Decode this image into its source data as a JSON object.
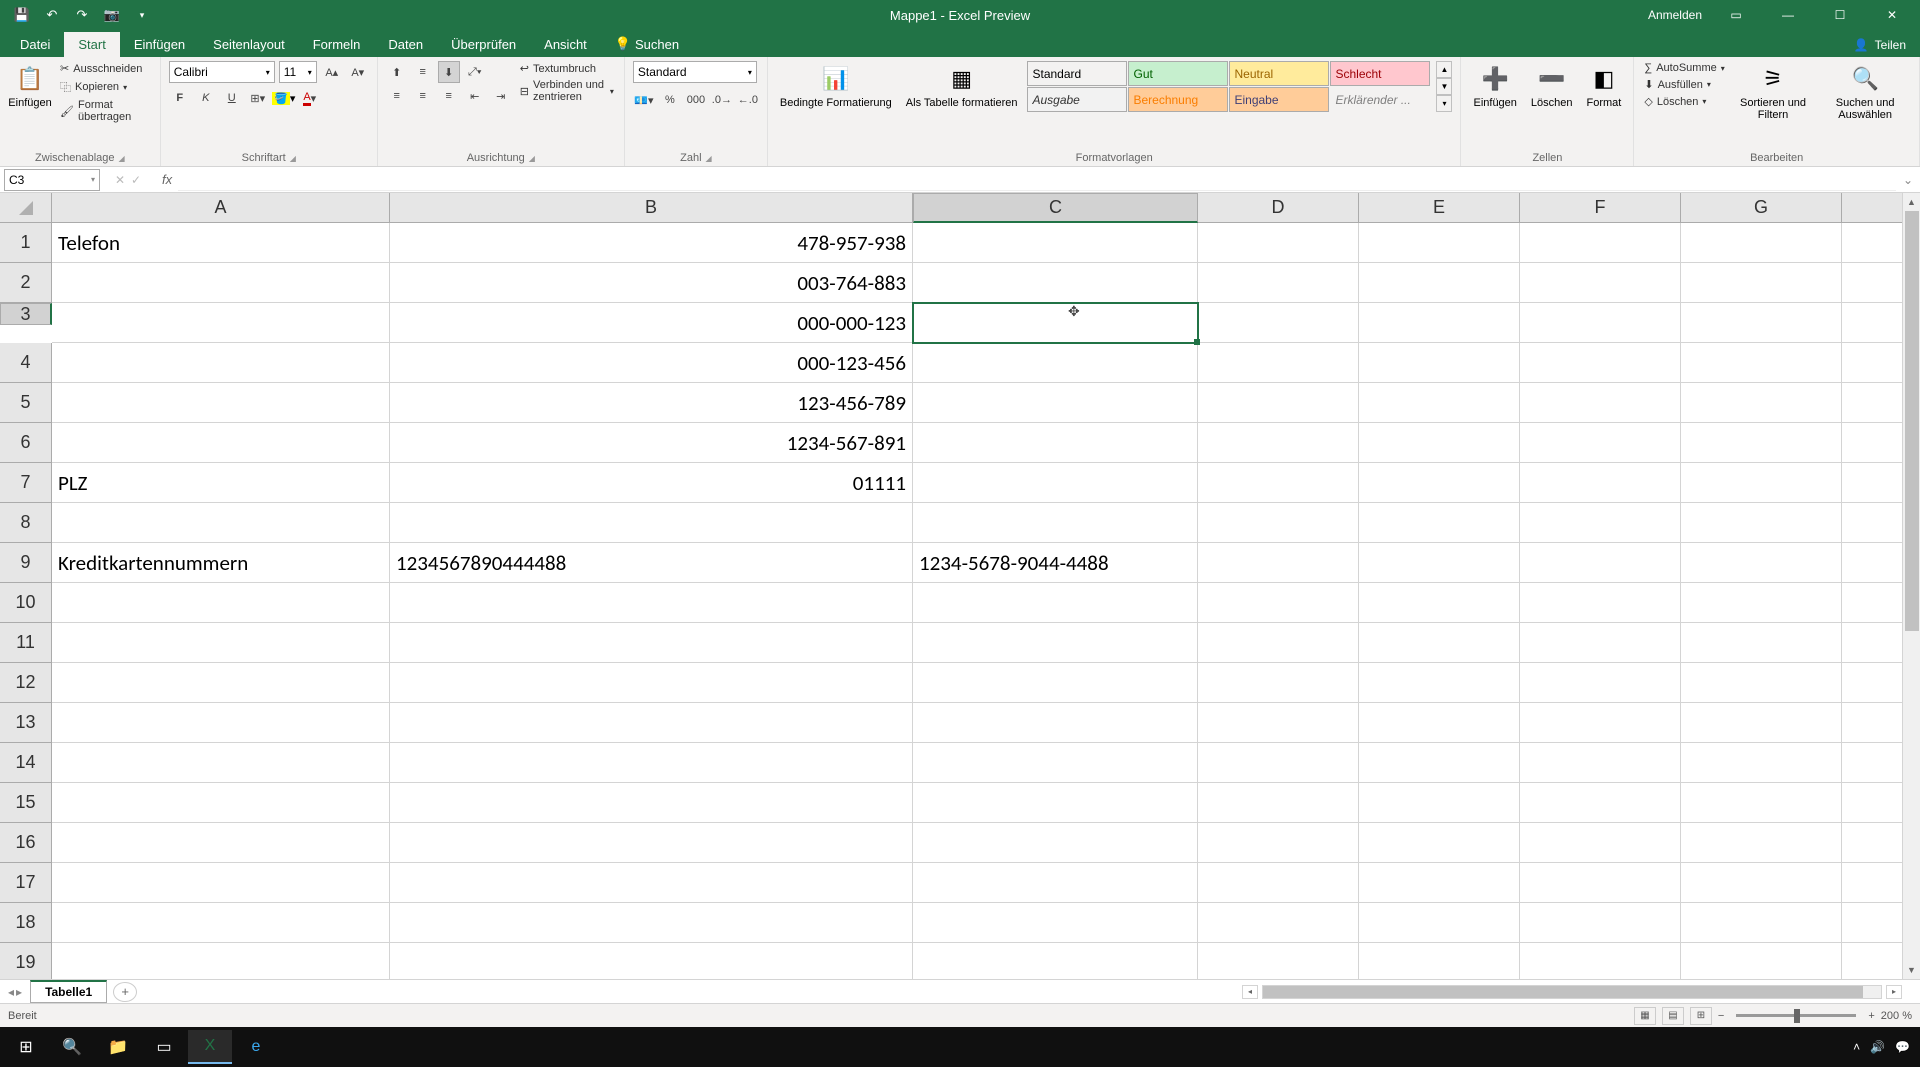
{
  "titlebar": {
    "title": "Mappe1 - Excel Preview",
    "signin": "Anmelden"
  },
  "tabs": {
    "file": "Datei",
    "start": "Start",
    "insert": "Einfügen",
    "layout": "Seitenlayout",
    "formulas": "Formeln",
    "data": "Daten",
    "review": "Überprüfen",
    "view": "Ansicht",
    "search": "Suchen",
    "share": "Teilen"
  },
  "ribbon": {
    "clipboard": {
      "paste": "Einfügen",
      "cut": "Ausschneiden",
      "copy": "Kopieren",
      "fmtpainter": "Format übertragen",
      "label": "Zwischenablage"
    },
    "font": {
      "name": "Calibri",
      "size": "11",
      "label": "Schriftart"
    },
    "align": {
      "wrap": "Textumbruch",
      "merge": "Verbinden und zentrieren",
      "label": "Ausrichtung"
    },
    "number": {
      "format": "Standard",
      "label": "Zahl"
    },
    "styles": {
      "cond": "Bedingte Formatierung",
      "table": "Als Tabelle formatieren",
      "s1": "Standard",
      "s2": "Gut",
      "s3": "Neutral",
      "s4": "Schlecht",
      "s5": "Ausgabe",
      "s6": "Berechnung",
      "s7": "Eingabe",
      "s8": "Erklärender ...",
      "label": "Formatvorlagen"
    },
    "cells": {
      "insert": "Einfügen",
      "delete": "Löschen",
      "format": "Format",
      "label": "Zellen"
    },
    "editing": {
      "autosum": "AutoSumme",
      "fill": "Ausfüllen",
      "clear": "Löschen",
      "sort": "Sortieren und Filtern",
      "find": "Suchen und Auswählen",
      "label": "Bearbeiten"
    }
  },
  "namebox": "C3",
  "columns": [
    "A",
    "B",
    "C",
    "D",
    "E",
    "F",
    "G",
    ""
  ],
  "rownums": [
    "1",
    "2",
    "3",
    "4",
    "5",
    "6",
    "7",
    "8",
    "9",
    "10",
    "11",
    "12",
    "13",
    "14",
    "15",
    "16",
    "17",
    "18",
    "19"
  ],
  "cells": {
    "A1": "Telefon",
    "B1": "478-957-938",
    "B2": "003-764-883",
    "B3": "000-000-123",
    "B4": "000-123-456",
    "B5": "123-456-789",
    "B6": "1234-567-891",
    "A7": "PLZ",
    "B7": "01111",
    "A9": "Kreditkartennummern",
    "B9": "1234567890444488",
    "C9": "1234-5678-9044-4488"
  },
  "selected_cell": "C3",
  "sheettab": "Tabelle1",
  "status": {
    "ready": "Bereit",
    "zoom": "200 %"
  },
  "taskbar_time": ""
}
